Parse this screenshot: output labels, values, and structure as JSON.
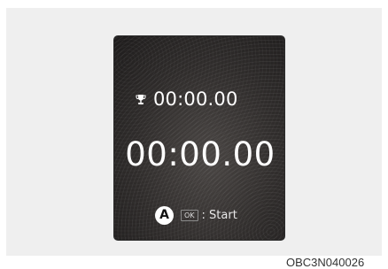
{
  "screen": {
    "best_time": "00:00.00",
    "main_time": "00:00.00",
    "marker": "A",
    "ok_key": "OK",
    "hint_text": ": Start"
  },
  "figure_code": "OBC3N040026",
  "icons": {
    "best_icon": "trophy-icon"
  }
}
